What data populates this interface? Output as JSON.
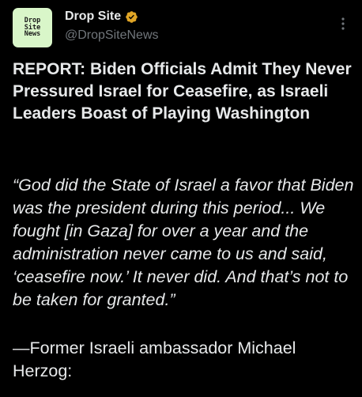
{
  "author": {
    "avatar_text": "Drop\nSite\nNews",
    "display_name": "Drop Site",
    "handle": "@DropSiteNews",
    "verified_icon": "verified-badge-icon",
    "verified_color": "#e0a526"
  },
  "more_icon": "more-vertical-icon",
  "post": {
    "headline": "REPORT: Biden Officials Admit They Never Pressured Israel for Ceasefire, as Israeli Leaders Boast of Playing Washington",
    "quote": "“God did the State of Israel a favor that Biden was the president during this period... We fought [in Gaza] for over a year and the administration never came to us and said, ‘ceasefire now.’ It never did. And that’s not to be taken for granted.”",
    "attribution": "—Former Israeli ambassador Michael Herzog:"
  },
  "colors": {
    "background": "#000000",
    "text": "#e7e9ea",
    "secondary_text": "#71767b",
    "avatar_bg": "#d9f6c9"
  }
}
